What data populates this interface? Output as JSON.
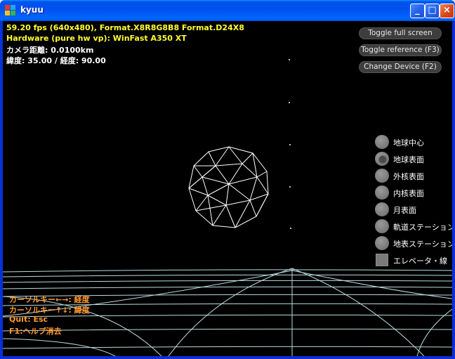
{
  "window": {
    "title": "kyuu",
    "buttons": {
      "minimize": "_",
      "maximize": "□",
      "close": "×"
    }
  },
  "stats": {
    "fps_line": "59.20 fps (640x480), Format.X8R8G8B8 Format.D24X8",
    "hardware_line": "Hardware (pure hw vp): WinFast A350 XT",
    "camera_distance": "カメラ距離: 0.0100km",
    "lat_lon": "緯度: 35.00 / 経度: 90.00"
  },
  "controls": {
    "toggle_fullscreen": "Toggle full screen",
    "toggle_reference": "Toggle reference (F3)",
    "change_device": "Change Device (F2)"
  },
  "view_options": [
    {
      "label": "地球中心",
      "kind": "radio",
      "selected": false
    },
    {
      "label": "地球表面",
      "kind": "radio",
      "selected": true
    },
    {
      "label": "外核表面",
      "kind": "radio",
      "selected": false
    },
    {
      "label": "内核表面",
      "kind": "radio",
      "selected": false
    },
    {
      "label": "月表面",
      "kind": "radio",
      "selected": false
    },
    {
      "label": "軌道ステーション",
      "kind": "radio",
      "selected": false
    },
    {
      "label": "地表ステーション",
      "kind": "radio",
      "selected": false
    },
    {
      "label": "エレベータ・線",
      "kind": "checkbox",
      "selected": false
    }
  ],
  "help": {
    "line1": "カーソルキー←→: 経度",
    "line2": "カーソルキー↑↓: 緯度",
    "line3": "Quit: Esc",
    "line4": "F1:ヘルプ消去"
  },
  "colors": {
    "titlebar": "#0053EE",
    "stats_yellow": "#FFFF33",
    "help_orange": "#FF9A2E",
    "grid_lines": "#CFF3F8",
    "wireframe": "#FFFFFF"
  }
}
